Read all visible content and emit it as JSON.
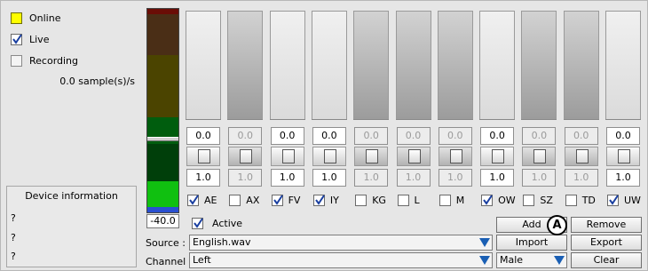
{
  "status": {
    "online_label": "Online",
    "live_label": "Live",
    "recording_label": "Recording",
    "rate_text": "0.0 sample(s)/s"
  },
  "device_info": {
    "title": "Device information",
    "lines": [
      "?",
      "?",
      "?"
    ]
  },
  "meter": {
    "value": "-40.0",
    "segment_colors": [
      "#6a0d06",
      "#4a2e16",
      "#4b4400",
      "#005d0e",
      "#003f0a",
      "#10c010",
      "#2a4fd0"
    ]
  },
  "channels": [
    {
      "name": "AE",
      "top": "0.0",
      "bottom": "1.0",
      "active": true
    },
    {
      "name": "AX",
      "top": "0.0",
      "bottom": "1.0",
      "active": false
    },
    {
      "name": "FV",
      "top": "0.0",
      "bottom": "1.0",
      "active": true
    },
    {
      "name": "IY",
      "top": "0.0",
      "bottom": "1.0",
      "active": true
    },
    {
      "name": "KG",
      "top": "0.0",
      "bottom": "1.0",
      "active": false
    },
    {
      "name": "L",
      "top": "0.0",
      "bottom": "1.0",
      "active": false
    },
    {
      "name": "M",
      "top": "0.0",
      "bottom": "1.0",
      "active": false
    },
    {
      "name": "OW",
      "top": "0.0",
      "bottom": "1.0",
      "active": true
    },
    {
      "name": "SZ",
      "top": "0.0",
      "bottom": "1.0",
      "active": false
    },
    {
      "name": "TD",
      "top": "0.0",
      "bottom": "1.0",
      "active": false
    },
    {
      "name": "UW",
      "top": "0.0",
      "bottom": "1.0",
      "active": true
    }
  ],
  "controls": {
    "active_label": "Active",
    "source_label": "Source :",
    "source_value": "English.wav",
    "channel_label": "Channel :",
    "channel_value": "Left",
    "gender_value": "Male"
  },
  "buttons": {
    "add": "Add",
    "remove": "Remove",
    "import": "Import",
    "export": "Export",
    "clear": "Clear"
  },
  "annotation": {
    "badge": "A"
  },
  "colors": {
    "led_online": "#ffff00",
    "dropdown_arrow": "#1a5fb4"
  }
}
